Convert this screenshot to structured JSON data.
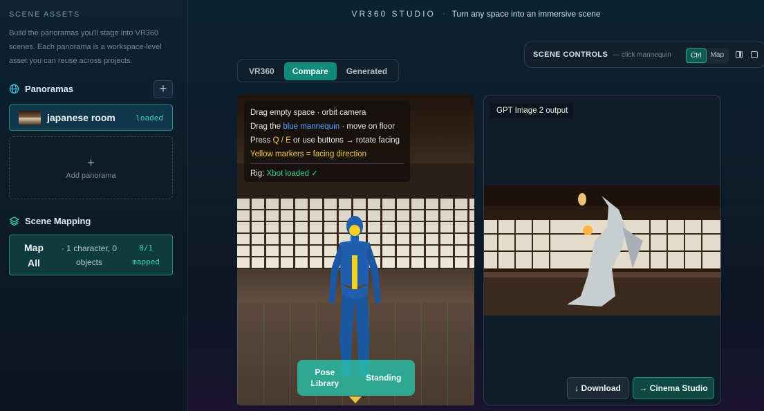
{
  "sidebar": {
    "title": "SCENE ASSETS",
    "description": "Build the panoramas you'll stage into VR360 scenes. Each panorama is a workspace-level asset you can reuse across projects.",
    "panoramas": {
      "heading": "Panoramas",
      "add_label": "+",
      "item": {
        "name": "japanese room",
        "status": "loaded"
      },
      "add_panorama_plus": "+",
      "add_panorama_label": "Add panorama"
    },
    "mapping": {
      "heading": "Scene Mapping",
      "map_all_line1": "Map",
      "map_all_line2": "All",
      "summary": "· 1 character, 0 objects",
      "count": "0/1",
      "count_label": "mapped"
    }
  },
  "header": {
    "brand": "VR360 STUDIO",
    "separator": "·",
    "tagline": "Turn any space into an immersive scene"
  },
  "scene_controls": {
    "title": "SCENE CONTROLS",
    "hint": "— click mannequin",
    "toggle": [
      "Ctrl",
      "Map"
    ],
    "active_toggle": "Ctrl"
  },
  "tabs": [
    "VR360",
    "Compare",
    "Generated"
  ],
  "active_tab": "Compare",
  "viewport": {
    "help": {
      "line1": "Drag empty space · orbit camera",
      "line2_pre": "Drag the ",
      "line2_highlight": "blue mannequin",
      "line2_post": " · move on floor",
      "line3_pre": "Press ",
      "line3_highlight": "Q / E",
      "line3_post": " or use buttons → rotate facing",
      "line4": "Yellow markers = facing direction",
      "rig_label": "Rig: ",
      "rig_status": "Xbot loaded ✓"
    },
    "pose_library_line1": "Pose",
    "pose_library_line2": "Library",
    "pose_standing": "Standing"
  },
  "output": {
    "label": "GPT Image 2 output",
    "download_label": "↓ Download",
    "cinema_label": "→ Cinema Studio"
  },
  "colors": {
    "accent": "#12897b",
    "loaded": "#3fd1b2",
    "blue_highlight": "#5aa8ff",
    "yellow_highlight": "#f5c842",
    "green_status": "#3fd18a"
  }
}
